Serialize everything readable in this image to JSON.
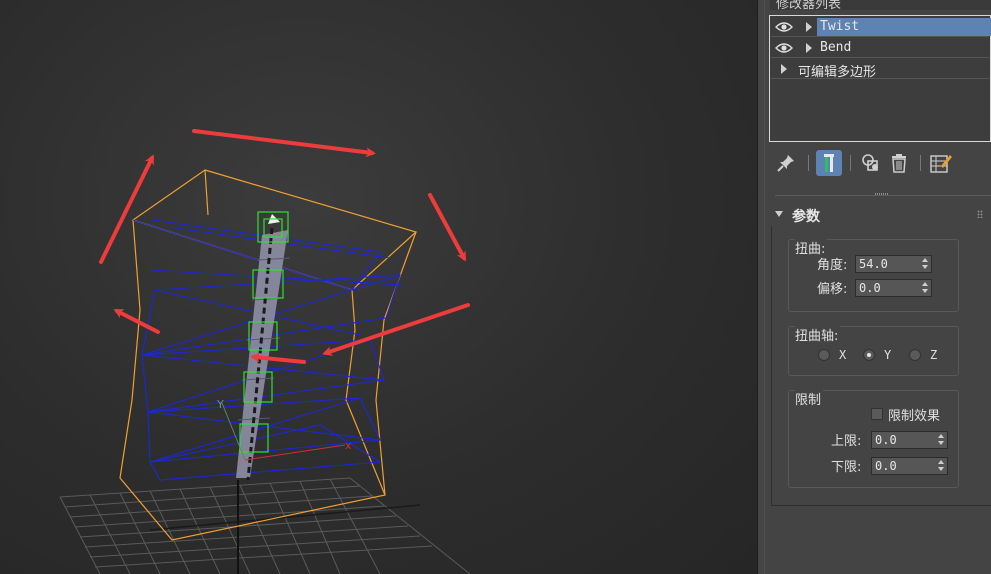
{
  "modifier_panel": {
    "header_title": "修改器列表",
    "stack": [
      {
        "label": "Twist",
        "visible_icon": "eye-icon",
        "selected": true
      },
      {
        "label": "Bend",
        "visible_icon": "eye-icon",
        "selected": false
      },
      {
        "label": "可编辑多边形",
        "visible_icon": "",
        "selected": false
      }
    ],
    "toolbar_icons": [
      "pin-stack-icon",
      "show-end-result-icon",
      "make-unique-icon",
      "remove-modifier-icon",
      "configure-sets-icon"
    ]
  },
  "parameters": {
    "rollout_title": "参数",
    "twist_group": {
      "title": "扭曲:",
      "angle_label": "角度:",
      "angle_value": "54.0",
      "bias_label": "偏移:",
      "bias_value": "0.0"
    },
    "axis_group": {
      "title": "扭曲轴:",
      "options": [
        {
          "label": "X",
          "selected": false
        },
        {
          "label": "Y",
          "selected": true
        },
        {
          "label": "Z",
          "selected": false
        }
      ]
    },
    "limits_group": {
      "title": "限制",
      "limit_effect_label": "限制效果",
      "limit_effect_checked": false,
      "upper_label": "上限:",
      "upper_value": "0.0",
      "lower_label": "下限:",
      "lower_value": "0.0"
    }
  },
  "viewport": {
    "axis_labels": {
      "x": "x",
      "y": "Y"
    },
    "colors": {
      "bounding_box": "#f0a030",
      "twist_lattice": "#1a28d8",
      "gizmo_nodes": "#30e030",
      "arrows": "#ee3c3c",
      "grid": "#5a5a5a",
      "selected_item": "#5d82b4"
    }
  }
}
